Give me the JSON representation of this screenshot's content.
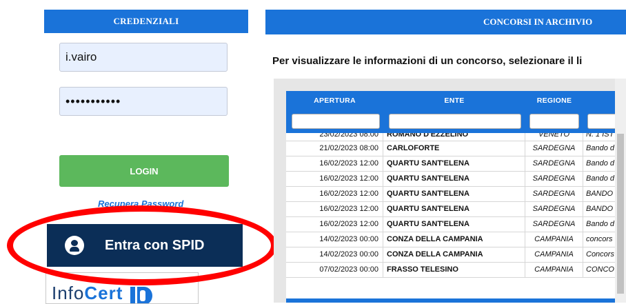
{
  "credentials": {
    "header": "CREDENZIALI",
    "username_value": "i.vairo",
    "password_value": "•••••••••••",
    "login_label": "LOGIN",
    "recover_label": "Recupera Password",
    "spid_label": "Entra con SPID",
    "infocert_prefix": "Info",
    "infocert_suffix": "Cert"
  },
  "archive": {
    "header": "CONCORSI IN ARCHIVIO",
    "instructions": "Per visualizzare le informazioni di un concorso, selezionare il li",
    "columns": [
      "APERTURA",
      "ENTE",
      "REGIONE",
      ""
    ],
    "rows": [
      {
        "apertura": "23/02/2023 08:00",
        "ente": "ROMANO D'EZZELINO",
        "regione": "VENETO",
        "descr": "N. 1 IST"
      },
      {
        "apertura": "21/02/2023 08:00",
        "ente": "CARLOFORTE",
        "regione": "SARDEGNA",
        "descr": "Bando d"
      },
      {
        "apertura": "16/02/2023 12:00",
        "ente": "QUARTU SANT'ELENA",
        "regione": "SARDEGNA",
        "descr": "Bando d"
      },
      {
        "apertura": "16/02/2023 12:00",
        "ente": "QUARTU SANT'ELENA",
        "regione": "SARDEGNA",
        "descr": "Bando d"
      },
      {
        "apertura": "16/02/2023 12:00",
        "ente": "QUARTU SANT'ELENA",
        "regione": "SARDEGNA",
        "descr": "BANDO"
      },
      {
        "apertura": "16/02/2023 12:00",
        "ente": "QUARTU SANT'ELENA",
        "regione": "SARDEGNA",
        "descr": "BANDO"
      },
      {
        "apertura": "16/02/2023 12:00",
        "ente": "QUARTU SANT'ELENA",
        "regione": "SARDEGNA",
        "descr": "Bando d"
      },
      {
        "apertura": "14/02/2023 00:00",
        "ente": "CONZA DELLA CAMPANIA",
        "regione": "CAMPANIA",
        "descr": "concors"
      },
      {
        "apertura": "14/02/2023 00:00",
        "ente": "CONZA DELLA CAMPANIA",
        "regione": "CAMPANIA",
        "descr": "Concors"
      },
      {
        "apertura": "07/02/2023 00:00",
        "ente": "FRASSO TELESINO",
        "regione": "CAMPANIA",
        "descr": "CONCO"
      }
    ]
  }
}
